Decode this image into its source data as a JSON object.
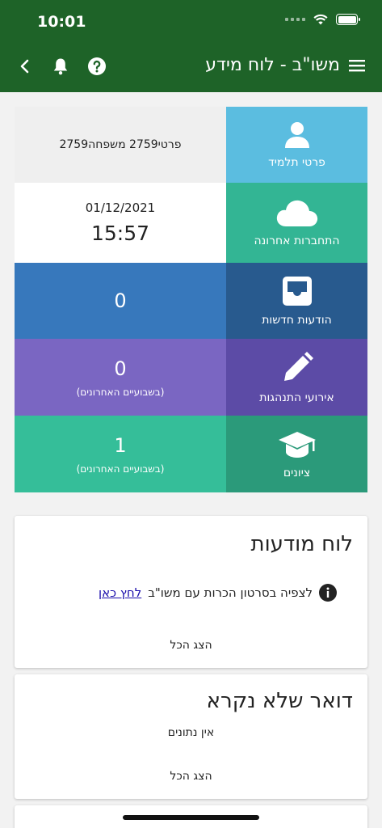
{
  "status_bar": {
    "time": "10:01"
  },
  "header": {
    "title": "משו\"ב - לוח מידע"
  },
  "tiles": [
    {
      "label": "פרטי תלמיד",
      "icon": "person-icon",
      "color": "#5bbde0",
      "value": "פרטי2759 משפחה2759",
      "value_bg": "#efefef",
      "value_color": "#222222"
    },
    {
      "label": "התחברות אחרונה",
      "icon": "cloud-icon",
      "color": "#33b594",
      "date": "01/12/2021",
      "time": "15:57",
      "value_bg": "#ffffff",
      "value_color": "#222222"
    },
    {
      "label": "הודעות חדשות",
      "icon": "inbox-icon",
      "color": "#285a8e",
      "value": "0",
      "value_bg": "#3778bc"
    },
    {
      "label": "אירועי התנהגות",
      "icon": "pencil-icon",
      "color": "#5c4ba6",
      "value": "0",
      "sub": "(בשבועיים האחרונים)",
      "value_bg": "#7a66c2"
    },
    {
      "label": "ציונים",
      "icon": "graduation-cap-icon",
      "color": "#2b9a7a",
      "value": "1",
      "sub": "(בשבועיים האחרונים)",
      "value_bg": "#35be99"
    }
  ],
  "notice_board": {
    "title": "לוח מודעות",
    "item_text": "לצפיה בסרטון הכרות עם משו\"ב",
    "item_link": "לחץ כאן",
    "show_all": "הצג הכל"
  },
  "unread_mail": {
    "title": "דואר שלא נקרא",
    "empty_text": "אין נתונים",
    "show_all": "הצג הכל"
  },
  "colors": {
    "header_bg": "#1e6328",
    "link": "#1a0dab"
  }
}
